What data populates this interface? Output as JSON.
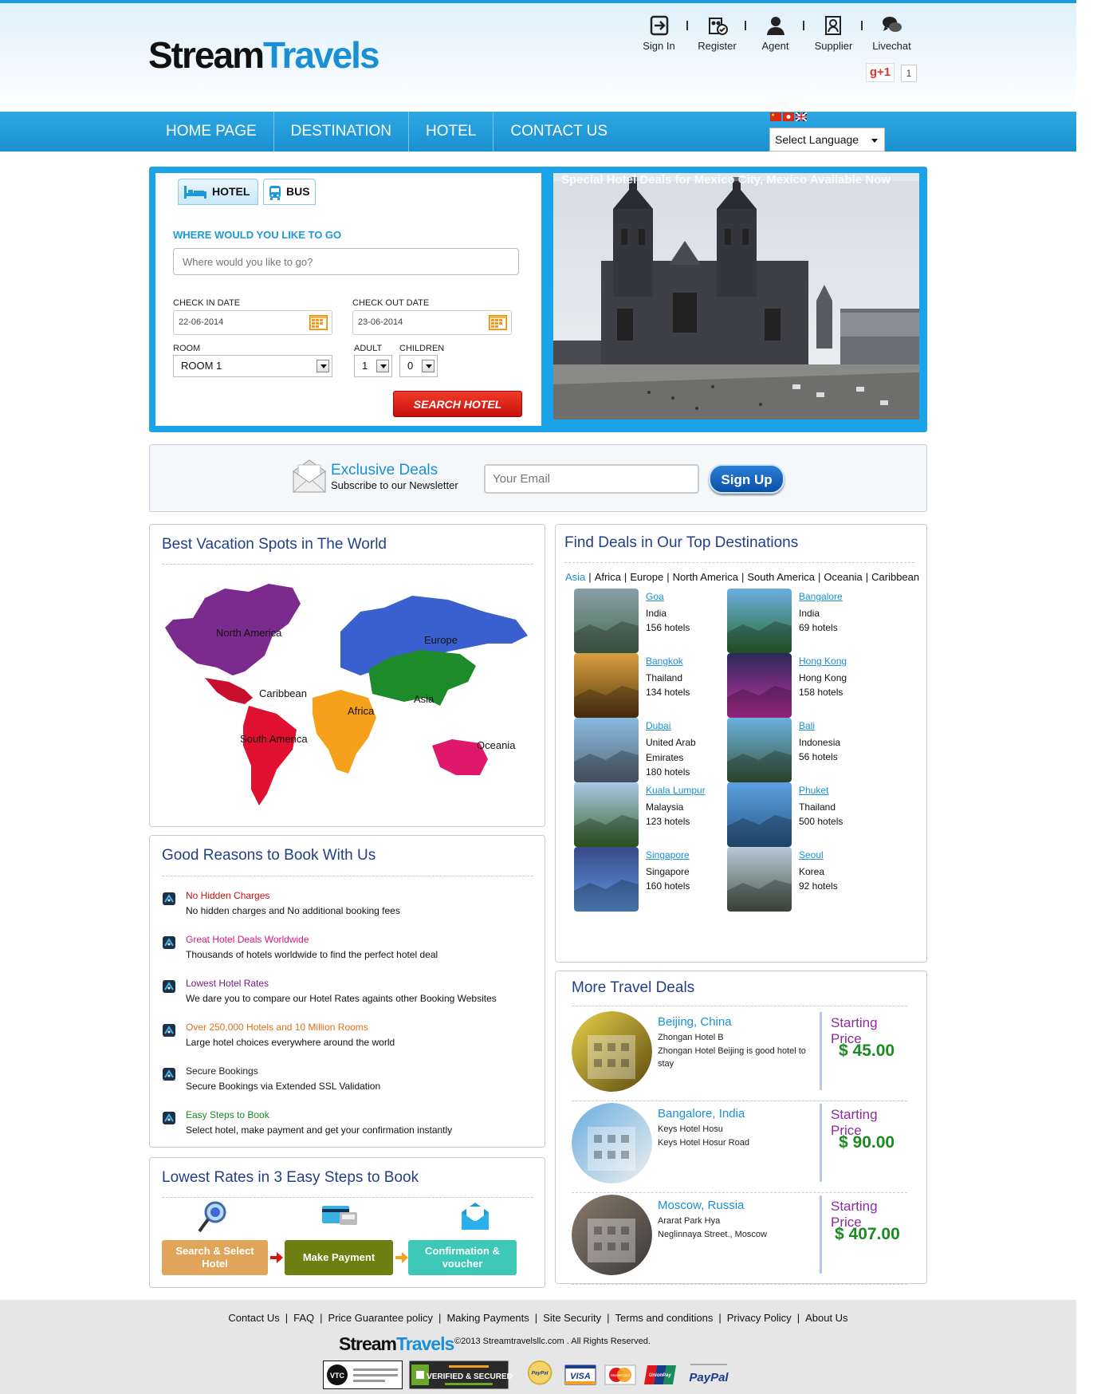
{
  "header": {
    "logo_part1": "Stream",
    "logo_part2": "Travels",
    "links": [
      {
        "label": "Sign In",
        "icon": "sign-in-icon"
      },
      {
        "label": "Register",
        "icon": "register-icon"
      },
      {
        "label": "Agent",
        "icon": "agent-icon"
      },
      {
        "label": "Supplier",
        "icon": "supplier-icon"
      },
      {
        "label": "Livechat",
        "icon": "chat-icon"
      }
    ],
    "gplus_label": "g+1",
    "gplus_count": "1"
  },
  "nav": {
    "items": [
      "HOME PAGE",
      "DESTINATION",
      "HOTEL",
      "CONTACT US"
    ],
    "language_select": "Select Language"
  },
  "search": {
    "tabs": [
      "HOTEL",
      "BUS"
    ],
    "where_label": "WHERE WOULD YOU LIKE TO GO",
    "where_placeholder": "Where would you like to go?",
    "checkin_label": "CHECK IN DATE",
    "checkin_value": "22-06-2014",
    "checkout_label": "CHECK OUT DATE",
    "checkout_value": "23-06-2014",
    "room_label": "ROOM",
    "room_value": "ROOM 1",
    "adult_label": "ADULT",
    "adult_value": "1",
    "children_label": "CHILDREN",
    "children_value": "0",
    "button": "SEARCH HOTEL",
    "banner_text": "Special Hotel Deals for Mexico City, Mexico Available Now"
  },
  "newsletter": {
    "title": "Exclusive Deals",
    "subtitle": "Subscribe to our Newsletter",
    "email_placeholder": "Your Email",
    "button": "Sign Up"
  },
  "vacation": {
    "title": "Best Vacation Spots in The World",
    "regions": [
      "North America",
      "Europe",
      "Caribbean",
      "Asia",
      "Africa",
      "South America",
      "Oceania"
    ]
  },
  "reasons": {
    "title": "Good Reasons to Book With Us",
    "items": [
      {
        "title": "No Hidden Charges",
        "desc": "No hidden charges and No additional booking fees",
        "color": "#cc1111"
      },
      {
        "title": "Great Hotel Deals Worldwide",
        "desc": "Thousands of hotels worldwide to find the perfect hotel deal",
        "color": "#d4187a"
      },
      {
        "title": "Lowest Hotel Rates",
        "desc": "We dare you to compare our Hotel Rates againts other Booking Websites",
        "color": "#7a1a8c"
      },
      {
        "title": "Over 250,000 Hotels and 10 Million Rooms",
        "desc": "Large hotel choices everywhere around the world",
        "color": "#e0701a"
      },
      {
        "title": "Secure Bookings",
        "desc": "Secure Bookings via Extended SSL Validation",
        "color": "#222222"
      },
      {
        "title": "Easy Steps to Book",
        "desc": "Select hotel, make payment and get your confirmation instantly",
        "color": "#1a8a22"
      }
    ]
  },
  "steps": {
    "title": "Lowest Rates in 3 Easy Steps to Book",
    "items": [
      {
        "label": "Search & Select Hotel",
        "color": "#e0a55a"
      },
      {
        "label": "Make Payment",
        "color": "#6e7f12"
      },
      {
        "label": "Confirmation & voucher",
        "color": "#3ec8b8"
      }
    ]
  },
  "destinations": {
    "title": "Find Deals in Our Top Destinations",
    "regions": [
      "Asia",
      "Africa",
      "Europe",
      "North America",
      "South America",
      "Oceania",
      "Caribbean"
    ],
    "items": [
      {
        "city": "Goa",
        "country": "India",
        "hotels": "156 hotels"
      },
      {
        "city": "Bangalore",
        "country": "India",
        "hotels": "69 hotels"
      },
      {
        "city": "Bangkok",
        "country": "Thailand",
        "hotels": "134 hotels"
      },
      {
        "city": "Hong Kong",
        "country": "Hong Kong",
        "hotels": "158 hotels"
      },
      {
        "city": "Dubai",
        "country": "United Arab Emirates",
        "hotels": "180 hotels"
      },
      {
        "city": "Bali",
        "country": "Indonesia",
        "hotels": "56 hotels"
      },
      {
        "city": "Kuala Lumpur",
        "country": "Malaysia",
        "hotels": "123 hotels"
      },
      {
        "city": "Phuket",
        "country": "Thailand",
        "hotels": "500 hotels"
      },
      {
        "city": "Singapore",
        "country": "Singapore",
        "hotels": "160 hotels"
      },
      {
        "city": "Seoul",
        "country": "Korea",
        "hotels": "92 hotels"
      }
    ]
  },
  "deals": {
    "title": "More Travel Deals",
    "items": [
      {
        "city": "Beijing, China",
        "hotel": "Zhongan Hotel B",
        "desc": "Zhongan Hotel Beijing is good hotel to stay",
        "label": "Starting Price",
        "price": "$ 45.00"
      },
      {
        "city": "Bangalore, India",
        "hotel": "Keys Hotel Hosu",
        "desc": "Keys Hotel Hosur Road",
        "label": "Starting Price",
        "price": "$ 90.00"
      },
      {
        "city": "Moscow, Russia",
        "hotel": "Ararat Park Hya",
        "desc": "Neglinnaya Street., Moscow",
        "label": "Starting Price",
        "price": "$ 407.00"
      }
    ]
  },
  "footer": {
    "links": [
      "Contact Us",
      "FAQ",
      "Price Guarantee policy",
      "Making Payments",
      "Site Security",
      "Terms and conditions",
      "Privacy Policy",
      "About Us"
    ],
    "logo_part1": "Stream",
    "logo_part2": "Travels",
    "copyright": "©2013 Streamtravelsllc.com . All Rights Reserved.",
    "badges": [
      "VTC",
      "VERIFIED & SECURED",
      "PayPal",
      "VISA",
      "MasterCard",
      "UnionPay",
      "PayPal"
    ]
  },
  "colors": {
    "brand_blue": "#1a8fd6",
    "nav_blue": "#1a90d0",
    "title_blue": "#243f8a",
    "search_red": "#d8140c",
    "price_green": "#1a8a22",
    "price_label_purple": "#8b2d9c"
  }
}
